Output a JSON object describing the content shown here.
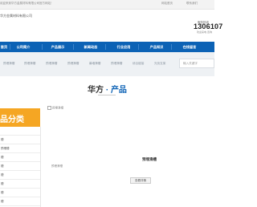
{
  "topbar": {
    "welcome": "欢迎来到华方金属材料有限公司官方网站！",
    "links": [
      "网站首页",
      "联系我们"
    ]
  },
  "header": {
    "company": "华方金属材料有限公司",
    "hotline_label": "服务热线",
    "hotline_number": "1306107",
    "hotline_sub": "欢迎来电·咨询"
  },
  "nav": {
    "items": [
      "首页",
      "公司简介",
      "产品展示",
      "新闻动态",
      "行业应用",
      "产品知识",
      "在线留言"
    ]
  },
  "banner": {
    "keywords": [
      "预埋滑槽",
      "预埋滑槽",
      "预埋滑槽",
      "预埋滑槽",
      "幕墙滑槽",
      "预埋滑槽",
      "综合链接",
      "光伏支架"
    ],
    "search_placeholder": "输入关键字"
  },
  "section": {
    "title_a": "华方",
    "title_dot": " · ",
    "title_b": "产品"
  },
  "sidebar": {
    "heading": "品分类",
    "items": [
      "",
      "槽",
      "预埋槽",
      "槽",
      "槽",
      "槽",
      "槽",
      "槽",
      "槽",
      "槽"
    ]
  },
  "product": {
    "image_alt": "预埋滑槽",
    "title": "预埋滑槽",
    "subtitle": "预埋滑槽",
    "detail_button": "查看详情"
  }
}
